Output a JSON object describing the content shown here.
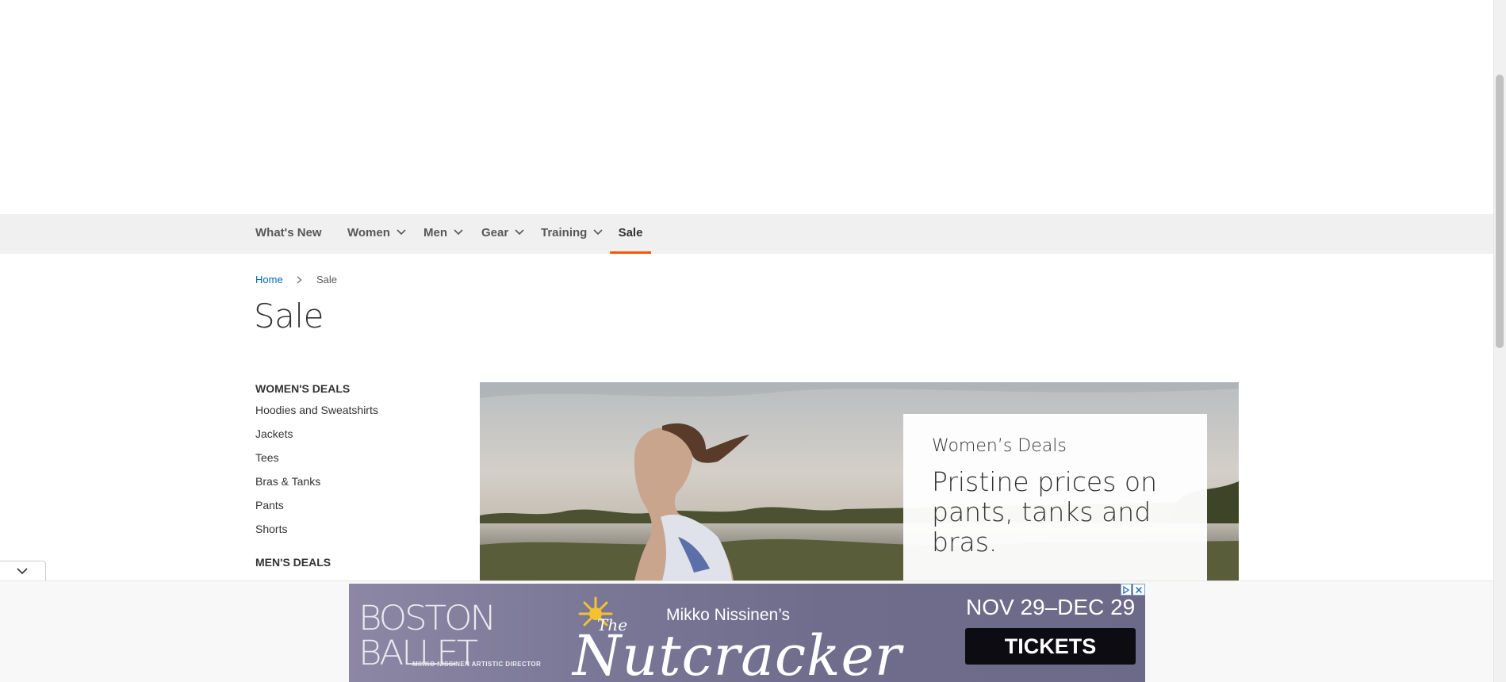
{
  "nav": {
    "items": [
      {
        "label": "What's New",
        "has_dropdown": false,
        "active": false
      },
      {
        "label": "Women",
        "has_dropdown": true,
        "active": false
      },
      {
        "label": "Men",
        "has_dropdown": true,
        "active": false
      },
      {
        "label": "Gear",
        "has_dropdown": true,
        "active": false
      },
      {
        "label": "Training",
        "has_dropdown": true,
        "active": false
      },
      {
        "label": "Sale",
        "has_dropdown": false,
        "active": true
      }
    ],
    "accent_color": "#ff5501"
  },
  "breadcrumb": {
    "home": "Home",
    "current": "Sale",
    "separator_icon": "chevron-right-icon"
  },
  "page": {
    "title": "Sale"
  },
  "sidebar": {
    "womens_title": "WOMEN'S DEALS",
    "womens_items": [
      "Hoodies and Sweatshirts",
      "Jackets",
      "Tees",
      "Bras & Tanks",
      "Pants",
      "Shorts"
    ],
    "mens_title": "MEN'S DEALS"
  },
  "hero": {
    "eyebrow": "Women’s Deals",
    "headline": "Pristine prices on pants, tanks and bras."
  },
  "ad": {
    "brand_line1": "BOSTON",
    "brand_line2": "BALLET",
    "director": "MIKKO NISSINEN ARTISTIC DIRECTOR",
    "presenter": "Mikko Nissinen’s",
    "the": "The",
    "show": "Nutcracker",
    "dates": "NOV 29–DEC 29",
    "cta": "TICKETS",
    "adchoices_icon": "adchoices-icon",
    "close_icon": "close-icon"
  },
  "colors": {
    "link": "#006bb4",
    "nav_bg": "#f0f0f0"
  }
}
